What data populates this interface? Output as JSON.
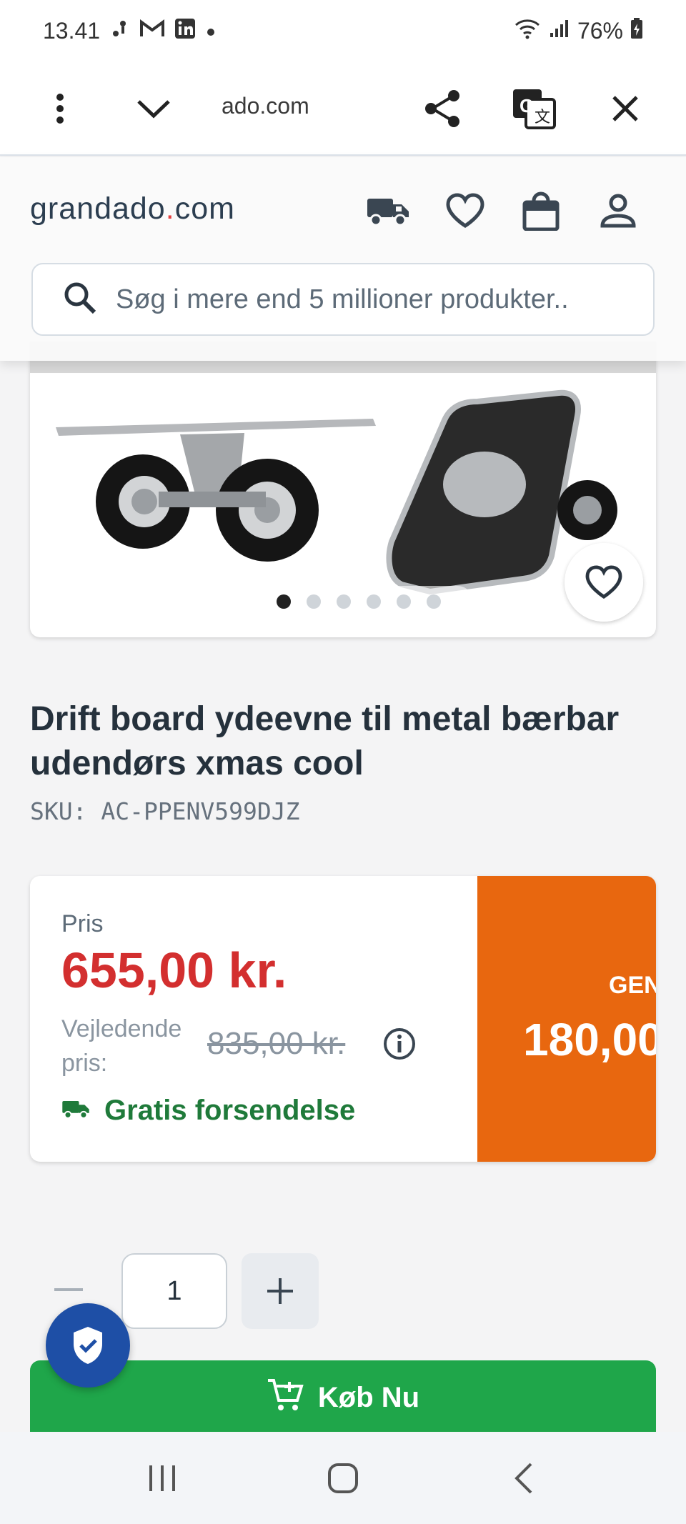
{
  "status_bar": {
    "time": "13.41",
    "battery": "76%",
    "icons": [
      "notification-dots-icon",
      "gmail-icon",
      "linkedin-icon",
      "wifi-icon",
      "signal-icon",
      "battery-icon"
    ]
  },
  "browser": {
    "url": "ado.com",
    "icons": [
      "more-vert-icon",
      "chevron-down-icon",
      "share-icon",
      "translate-icon",
      "close-icon"
    ]
  },
  "site_header": {
    "logo_main": "grandado",
    "logo_dot": ".",
    "logo_tld": "com",
    "icons": [
      "truck-icon",
      "heart-icon",
      "bag-icon",
      "user-icon"
    ],
    "search_placeholder": "Søg i mere end 5 millioner produkter.."
  },
  "gallery": {
    "image_count": 6,
    "active_index": 0
  },
  "product": {
    "title": "Drift board ydeevne til metal bærbar udendørs xmas cool",
    "sku": "SKU: AC-PPENV599DJZ"
  },
  "price": {
    "label": "Pris",
    "value": "655,00 kr.",
    "rrp_label": "Vejledende pris:",
    "rrp_value": "835,00 kr.",
    "shipping": "Gratis forsendelse",
    "savings_label": "GEN",
    "savings_value": "180,00"
  },
  "quantity": {
    "value": "1",
    "minus": "—",
    "plus": "+"
  },
  "buy": {
    "label": "Køb Nu"
  },
  "colors": {
    "price_red": "#d32f2f",
    "savings_orange": "#e8670f",
    "buy_green": "#1fa64a",
    "shipping_green": "#1f7a3a",
    "badge_blue": "#1e4fa6",
    "logo_dot_red": "#e53e3e"
  }
}
